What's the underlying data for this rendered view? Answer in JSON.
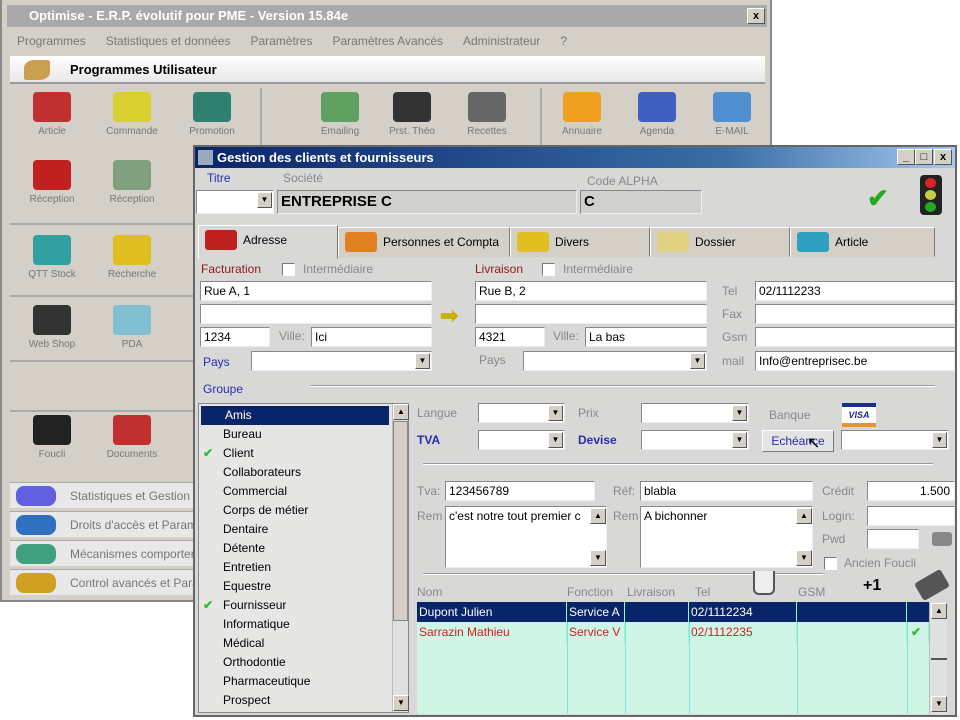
{
  "main_window": {
    "title": "Optimise  -  E.R.P. évolutif pour PME  -  Version 15.84e",
    "close_label": "x",
    "menu": [
      "Programmes",
      "Statistiques et données",
      "Paramètres",
      "Paramètres Avancés",
      "Administrateur",
      "?"
    ],
    "header": "Programmes Utilisateur",
    "top_icons": [
      {
        "label": "Article",
        "color": "#c03030"
      },
      {
        "label": "Commande",
        "color": "#d8d030"
      },
      {
        "label": "Promotion",
        "color": "#308070"
      },
      {
        "label": "Emailing",
        "color": "#60a060"
      },
      {
        "label": "Prst. Théo",
        "color": "#333333"
      },
      {
        "label": "Recettes",
        "color": "#666666"
      },
      {
        "label": "Annuaire",
        "color": "#f0a020"
      },
      {
        "label": "Agenda",
        "color": "#4060c0"
      },
      {
        "label": "E-MAIL",
        "color": "#5090d0"
      }
    ],
    "left_icons": [
      {
        "label": "Réception",
        "color": "#c02020"
      },
      {
        "label": "Réception",
        "color": "#80a080"
      },
      {
        "label": "QTT Stock",
        "color": "#30a0a0"
      },
      {
        "label": "Recherche",
        "color": "#e0c020"
      },
      {
        "label": "Web Shop",
        "color": "#333333"
      },
      {
        "label": "PDA",
        "color": "#80c0d0"
      },
      {
        "label": "Foucli",
        "color": "#222222"
      },
      {
        "label": "Documents",
        "color": "#c03030"
      }
    ],
    "side_sections": [
      {
        "label": "Statistiques et Gestion",
        "color": "#6060e0"
      },
      {
        "label": "Droits d'accès et Paramètres",
        "color": "#3070c0"
      },
      {
        "label": "Mécanismes comportementaux",
        "color": "#40a080"
      },
      {
        "label": "Control avancés et Paramètres",
        "color": "#d0a020"
      }
    ]
  },
  "dialog": {
    "title": "Gestion des clients et fournisseurs",
    "buttons": {
      "minimize": "_",
      "maximize": "□",
      "close": "x"
    },
    "titre_label": "Titre",
    "titre_value": "",
    "societe_label": "Société",
    "societe_value": "ENTREPRISE C",
    "code_label": "Code ALPHA",
    "code_value": "C",
    "tabs": [
      {
        "label": "Adresse",
        "color": "#c02020"
      },
      {
        "label": "Personnes et Compta",
        "color": "#e08020"
      },
      {
        "label": "Divers",
        "color": "#e0c020"
      },
      {
        "label": "Dossier",
        "color": "#e0d080"
      },
      {
        "label": "Article",
        "color": "#30a0c0"
      }
    ],
    "facturation": {
      "label": "Facturation",
      "intermediaire": "Intermédiaire",
      "line1": "Rue A, 1",
      "line2": "",
      "cp": "1234",
      "ville_label": "Ville:",
      "ville": "Ici",
      "pays_label": "Pays",
      "pays": ""
    },
    "livraison": {
      "label": "Livraison",
      "intermediaire": "Intermédiaire",
      "line1": "Rue B, 2",
      "line2": "",
      "cp": "4321",
      "ville_label": "Ville:",
      "ville": "La bas",
      "pays_label": "Pays",
      "pays": ""
    },
    "contact": {
      "tel_label": "Tel",
      "tel": "02/1112233",
      "fax_label": "Fax",
      "fax": "",
      "gsm_label": "Gsm",
      "gsm": "",
      "mail_label": "mail",
      "mail": "Info@entreprisec.be"
    },
    "groupe_label": "Groupe",
    "groups": [
      {
        "label": "Amis",
        "checked": false,
        "selected": true
      },
      {
        "label": "Bureau",
        "checked": false
      },
      {
        "label": "Client",
        "checked": true
      },
      {
        "label": "Collaborateurs",
        "checked": false
      },
      {
        "label": "Commercial",
        "checked": false
      },
      {
        "label": "Corps de métier",
        "checked": false
      },
      {
        "label": "Dentaire",
        "checked": false
      },
      {
        "label": "Détente",
        "checked": false
      },
      {
        "label": "Entretien",
        "checked": false
      },
      {
        "label": "Equestre",
        "checked": false
      },
      {
        "label": "Fournisseur",
        "checked": true
      },
      {
        "label": "Informatique",
        "checked": false
      },
      {
        "label": "Médical",
        "checked": false
      },
      {
        "label": "Orthodontie",
        "checked": false
      },
      {
        "label": "Pharmaceutique",
        "checked": false
      },
      {
        "label": "Prospect",
        "checked": false
      }
    ],
    "settings": {
      "langue_label": "Langue",
      "prix_label": "Prix",
      "banque_label": "Banque",
      "visa_label": "VISA",
      "tva_label": "TVA",
      "devise_label": "Devise",
      "echeance_label": "Echéance"
    },
    "fiscal": {
      "tva_label": "Tva:",
      "tva": "123456789",
      "ref_label": "Réf:",
      "ref": "blabla",
      "credit_label": "Crédit",
      "credit": "1.500",
      "rem_label": "Rem",
      "rem1": "c'est notre tout premier c",
      "rem2": "A bichonner",
      "login_label": "Login:",
      "login": "",
      "pwd_label": "Pwd",
      "pwd": "",
      "ancien_label": "Ancien Foucli"
    },
    "contacts_headers": [
      "Nom",
      "Fonction",
      "Livraison",
      "Tel",
      "GSM"
    ],
    "contacts": [
      {
        "nom": "Dupont Julien",
        "fonction": "Service A",
        "livraison": "",
        "tel": "02/1112234",
        "gsm": "",
        "checked": false,
        "selected": true
      },
      {
        "nom": "Sarrazin Mathieu",
        "fonction": "Service V",
        "livraison": "",
        "tel": "02/1112235",
        "gsm": "",
        "checked": true,
        "selected": false
      }
    ],
    "add_label": "+1"
  }
}
